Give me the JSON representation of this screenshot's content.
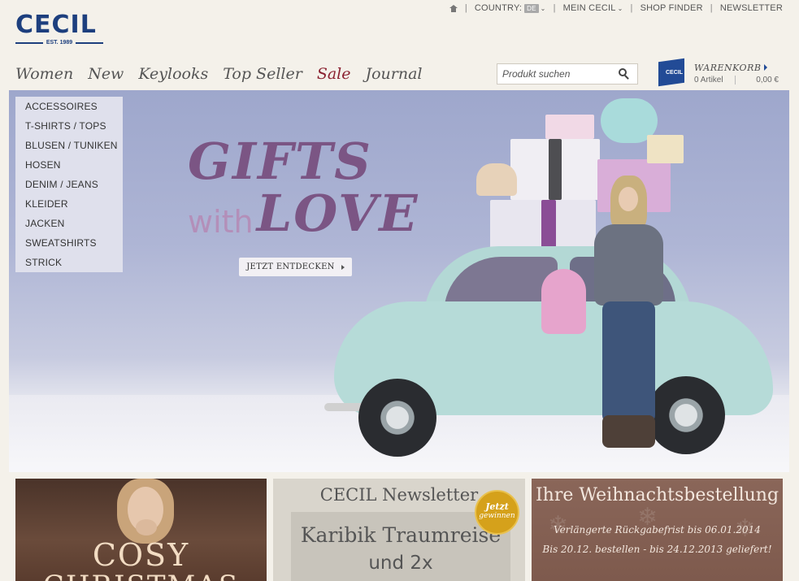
{
  "topbar": {
    "country_label": "COUNTRY:",
    "country_code": "DE",
    "mein_cecil": "MEIN CECIL",
    "shop_finder": "SHOP FINDER",
    "newsletter": "NEWSLETTER"
  },
  "logo": {
    "name": "CECIL",
    "est": "EST. 1989"
  },
  "nav": {
    "items": [
      "Women",
      "New",
      "Keylooks",
      "Top Seller",
      "Sale",
      "Journal"
    ]
  },
  "search": {
    "placeholder": "Produkt suchen"
  },
  "cart": {
    "title": "WARENKORB",
    "count": "0 Artikel",
    "total": "0,00 €",
    "bag_text": "CECIL"
  },
  "categories": [
    "ACCESSOIRES",
    "T-SHIRTS / TOPS",
    "BLUSEN / TUNIKEN",
    "HOSEN",
    "DENIM / JEANS",
    "KLEIDER",
    "JACKEN",
    "SWEATSHIRTS",
    "STRICK"
  ],
  "hero": {
    "line1": "GIFTS",
    "with": "with",
    "love": "LOVE",
    "cta": "JETZT ENTDECKEN"
  },
  "tiles": {
    "cosy": {
      "line1": "COSY",
      "line2": "CHRISTMAS"
    },
    "newsletter": {
      "title": "CECIL Newsletter",
      "line1": "Karibik Traumreise",
      "line2": "und 2x",
      "seal_line1": "Jetzt",
      "seal_line2": "gewinnen"
    },
    "xmas": {
      "title": "Ihre Weihnachtsbestellung",
      "line1": "Verlängerte Rückgabefrist bis 06.01.2014",
      "line2": "Bis 20.12. bestellen - bis 24.12.2013 geliefert!"
    }
  },
  "colors": {
    "brand": "#1d3f7e",
    "sale": "#8b2231",
    "hero_text": "#7b5584"
  }
}
